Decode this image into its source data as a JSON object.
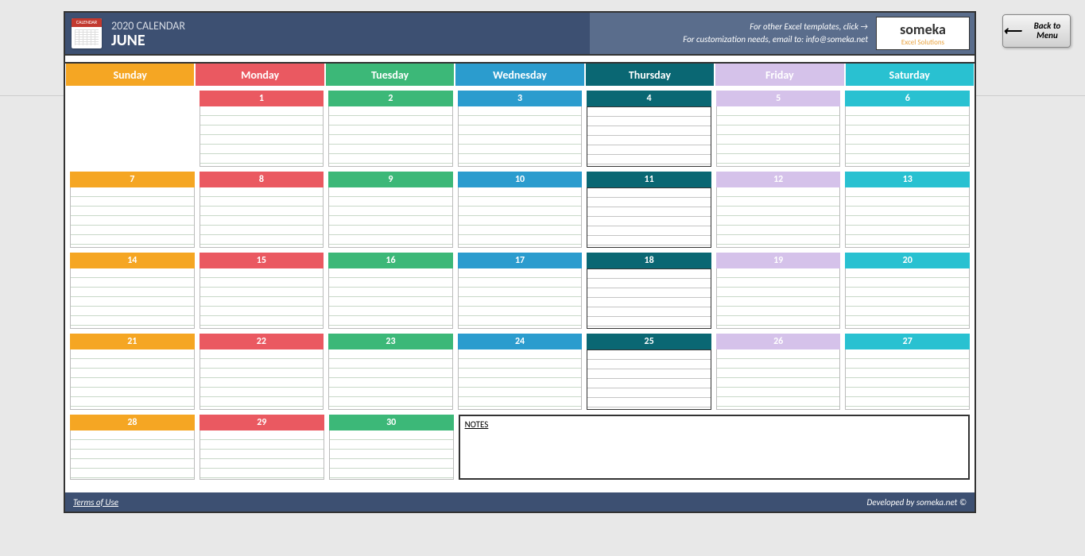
{
  "header": {
    "year": "2020 CALENDAR",
    "month": "JUNE",
    "info1": "For other Excel templates, click",
    "info2": "For customization needs, email to: info@someka.net",
    "logo": "someka",
    "logo_sub": "Excel Solutions"
  },
  "days": [
    "Sunday",
    "Monday",
    "Tuesday",
    "Wednesday",
    "Thursday",
    "Friday",
    "Saturday"
  ],
  "colors": {
    "sun": "#f5a623",
    "mon": "#ea5961",
    "tue": "#3cb878",
    "wed": "#2b9cce",
    "thu": "#0a6773",
    "fri": "#d5c2ea",
    "sat": "#29c1d1"
  },
  "weeks": [
    [
      null,
      "1",
      "2",
      "3",
      "4",
      "5",
      "6"
    ],
    [
      "7",
      "8",
      "9",
      "10",
      "11",
      "12",
      "13"
    ],
    [
      "14",
      "15",
      "16",
      "17",
      "18",
      "19",
      "20"
    ],
    [
      "21",
      "22",
      "23",
      "24",
      "25",
      "26",
      "27"
    ],
    [
      "28",
      "29",
      "30",
      null,
      null,
      null,
      null
    ]
  ],
  "notes_label": "NOTES",
  "footer": {
    "left": "Terms of Use",
    "right": "Developed by someka.net ©"
  },
  "back_btn": "Back to Menu"
}
